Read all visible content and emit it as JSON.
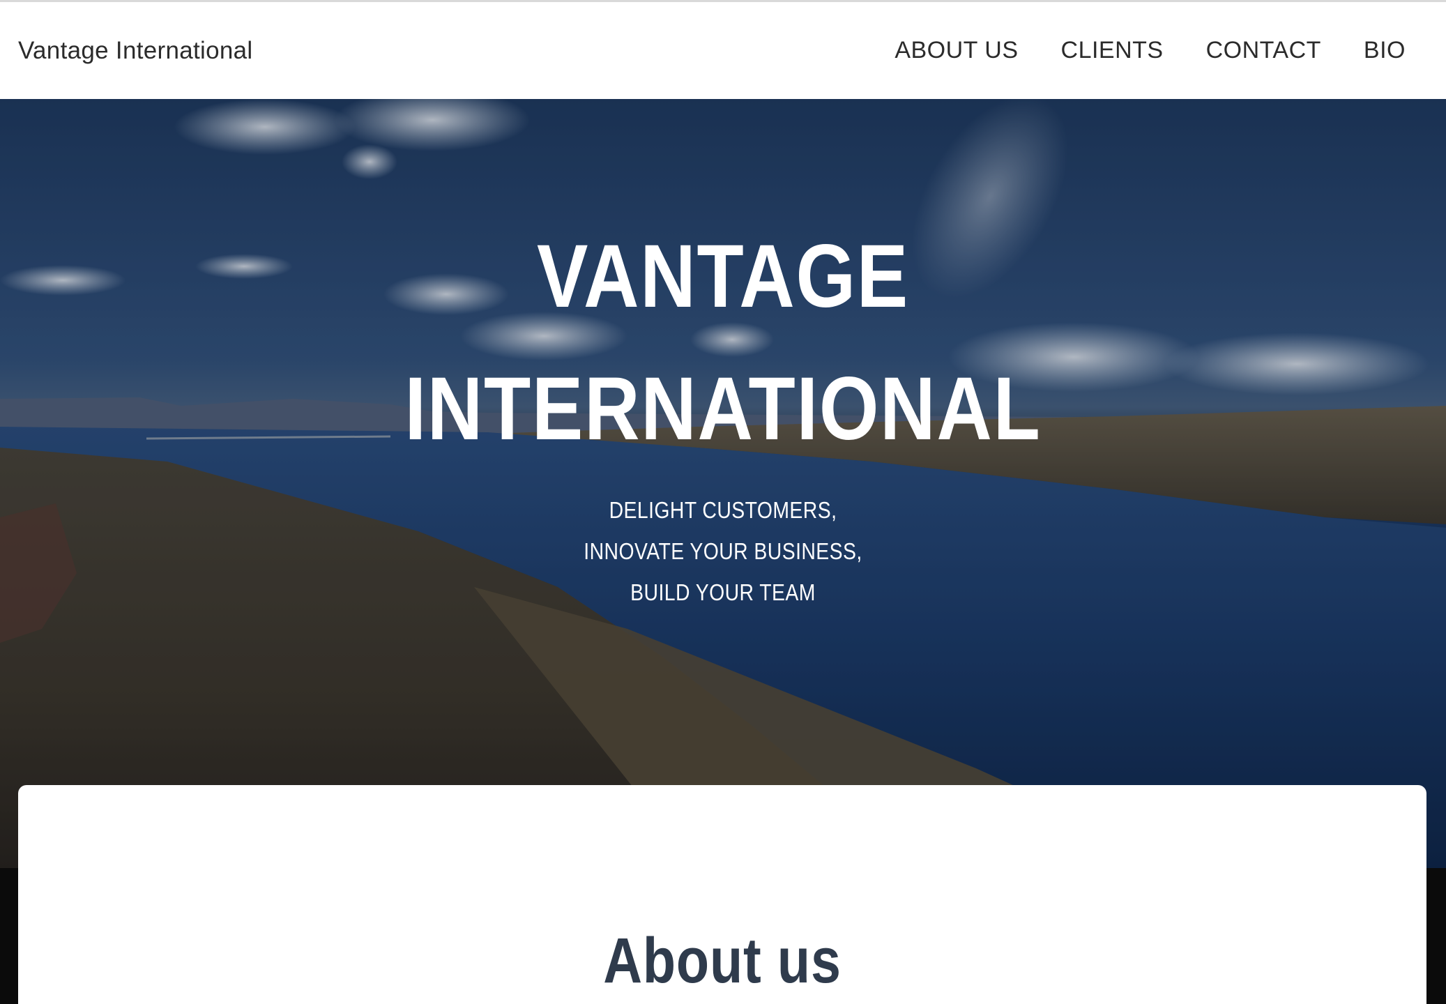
{
  "header": {
    "brand": "Vantage International",
    "nav": [
      {
        "label": "ABOUT US"
      },
      {
        "label": "CLIENTS"
      },
      {
        "label": "CONTACT"
      },
      {
        "label": "BIO"
      }
    ]
  },
  "hero": {
    "title_line1": "VANTAGE",
    "title_line2": "INTERNATIONAL",
    "tagline": [
      "DELIGHT CUSTOMERS,",
      "INNOVATE YOUR BUSINESS,",
      "BUILD YOUR TEAM"
    ]
  },
  "about": {
    "heading": "About us"
  },
  "colors": {
    "header_bg": "#ffffff",
    "text_dark": "#2b2b2b",
    "heading_color": "#2f3b4c",
    "hero_text": "#ffffff"
  }
}
